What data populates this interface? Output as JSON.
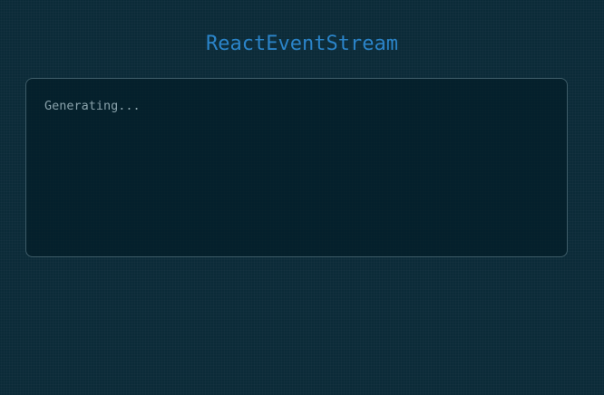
{
  "header": {
    "title": "ReactEventStream"
  },
  "stream": {
    "status_text": "Generating..."
  }
}
